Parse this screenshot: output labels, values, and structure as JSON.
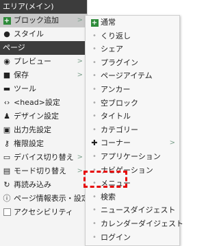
{
  "main_menu": {
    "section_area": "エリア(メイン)",
    "add_block": "ブロック追加",
    "style": "スタイル",
    "section_page": "ページ",
    "preview": "プレビュー",
    "save": "保存",
    "tools": "ツール",
    "head_settings": "<head>設定",
    "design_settings": "デザイン設定",
    "output_settings": "出力先設定",
    "permission_settings": "権限設定",
    "device_switch": "デバイス切り替え",
    "mode_switch": "モード切り替え",
    "reload": "再読み込み",
    "page_info": "ページ情報表示・設定",
    "accessibility": "アクセシビリティ",
    "arrow": ">"
  },
  "sub_menu": {
    "items": [
      "通常",
      "くり返し",
      "シェア",
      "プラグイン",
      "ページアイテム",
      "アンカー",
      "空ブロック",
      "タイトル",
      "カテゴリー",
      "コーナー",
      "アプリケーション",
      "ナビゲーション",
      "メニュー",
      "検索",
      "ニュースダイジェスト",
      "カレンダーダイジェスト",
      "ログイン"
    ],
    "arrow": ">"
  },
  "highlight_color": "#e60000"
}
